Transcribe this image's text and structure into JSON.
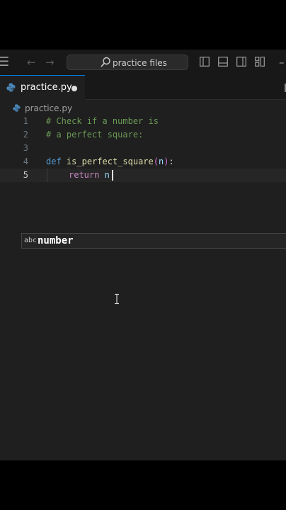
{
  "titlebar": {
    "search_placeholder": "practice files"
  },
  "tab": {
    "label": "practice.py"
  },
  "breadcrumb": {
    "file": "practice.py"
  },
  "editor": {
    "lines": [
      {
        "number": "1",
        "text": "# Check if a number is"
      },
      {
        "number": "2",
        "text": "# a perfect square:"
      },
      {
        "number": "3",
        "text": ""
      },
      {
        "number": "4",
        "keyword": "def",
        "function": "is_perfect_square",
        "open": "(",
        "param": "n",
        "close": ")",
        "colon": ":"
      },
      {
        "number": "5",
        "keyword": "return",
        "typed": "n"
      }
    ]
  },
  "suggest": {
    "kind": "abc",
    "label": "number"
  },
  "colors": {
    "accent": "#0078d4",
    "comment": "#6a9955",
    "keyword": "#569cd6",
    "function": "#dcdcaa",
    "return_keyword": "#c586c0"
  }
}
